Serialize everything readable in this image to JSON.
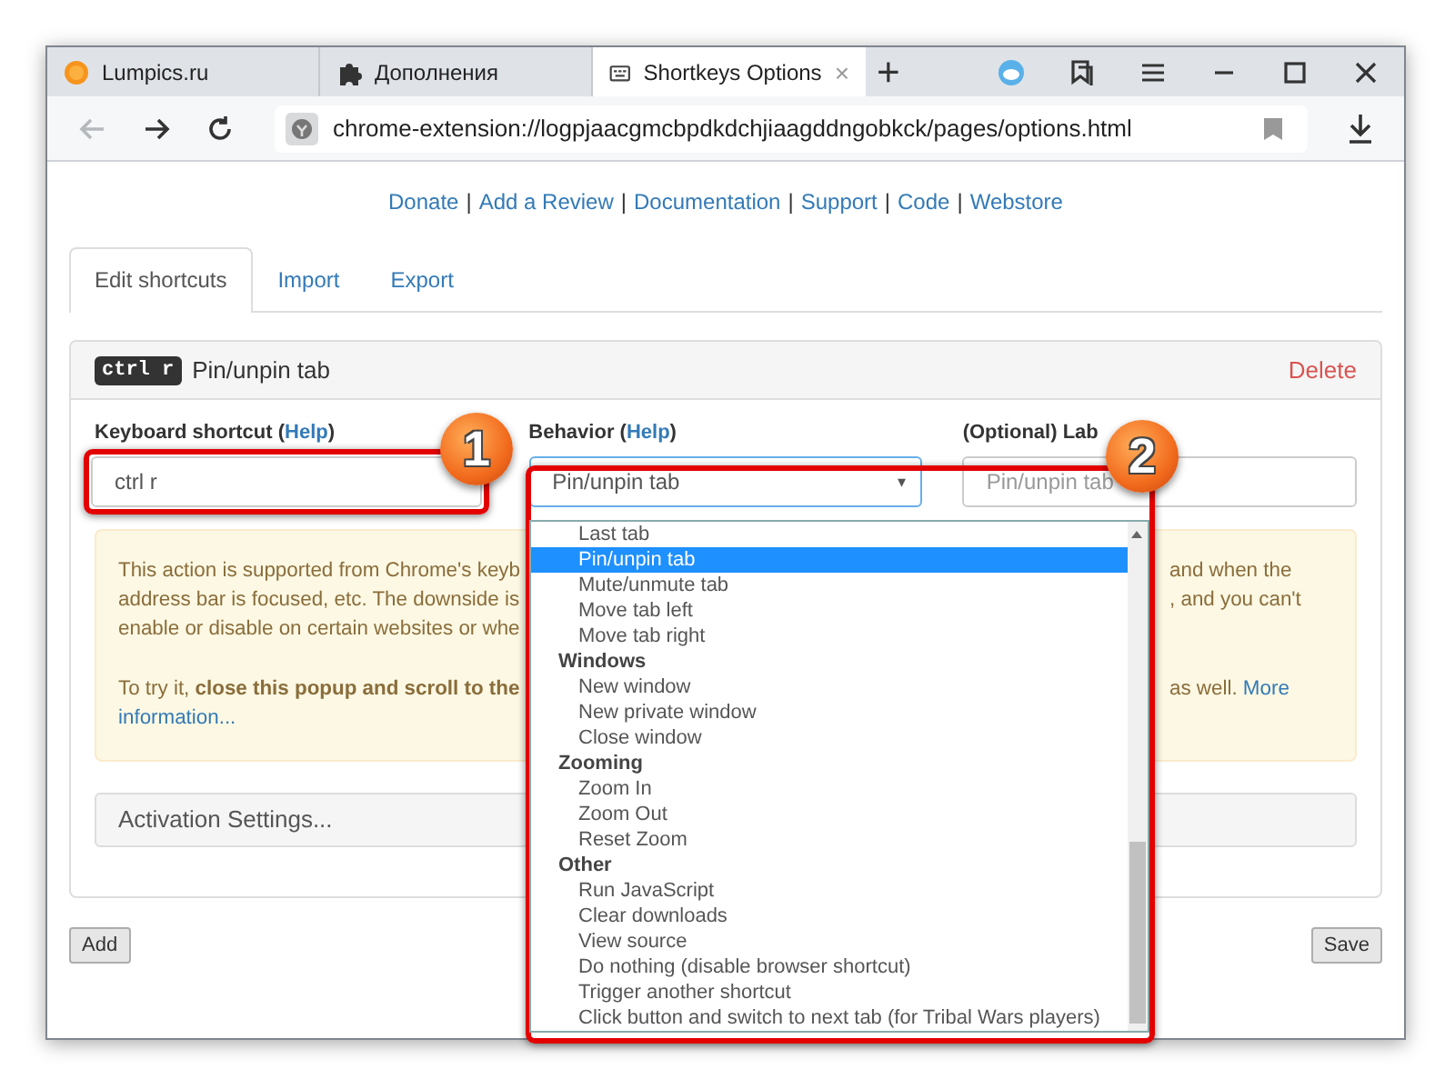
{
  "browser": {
    "tabs": [
      {
        "kind": "site",
        "title": "Lumpics.ru",
        "selected": false
      },
      {
        "kind": "puzzle",
        "title": "Дополнения",
        "selected": false
      },
      {
        "kind": "keyboard",
        "title": "Shortkeys Options",
        "selected": true,
        "close": "×"
      }
    ],
    "new_tab": "+",
    "nav": [
      {
        "kind": "back",
        "disabled": true
      },
      {
        "kind": "forward",
        "disabled": false
      },
      {
        "kind": "reload",
        "disabled": false
      }
    ],
    "url": "chrome-extension://logpjaacgmcbpdkdchjiaagddngobkck/pages/options.html"
  },
  "links": [
    {
      "label": "Donate",
      "separator": "|"
    },
    {
      "label": "Add a Review",
      "separator": "|"
    },
    {
      "label": "Documentation",
      "separator": "|"
    },
    {
      "label": "Support",
      "separator": "|"
    },
    {
      "label": "Code",
      "separator": "|"
    },
    {
      "label": "Webstore"
    }
  ],
  "page_tabs": [
    {
      "label": "Edit shortcuts",
      "selected": true
    },
    {
      "label": "Import",
      "selected": false
    },
    {
      "label": "Export",
      "selected": false
    }
  ],
  "shortcut_panel": {
    "keys": "ctrl r",
    "title": "Pin/unpin tab",
    "delete": "Delete",
    "fields": [
      {
        "kind": "input",
        "label": "Keyboard shortcut (",
        "help": "Help",
        "label_end": ")",
        "value": "ctrl r",
        "highlighted": true
      },
      {
        "kind": "select",
        "label": "Behavior (",
        "help": "Help",
        "label_end": ")",
        "value": "Pin/unpin tab",
        "caret": "▾",
        "highlighted": true
      },
      {
        "kind": "input",
        "label": "(Optional) Lab",
        "placeholder": "Pin/unpin tab",
        "highlighted": false
      }
    ],
    "alert": [
      {
        "kind": "row",
        "left": "This action is supported from Chrome's keyb",
        "right": "and when the"
      },
      {
        "kind": "row",
        "left": "address bar is focused, etc. The downside is",
        "right": ", and you can't"
      },
      {
        "kind": "row",
        "left": "enable or disable on certain websites or whe"
      },
      {
        "kind": "gap"
      },
      {
        "kind": "row",
        "left": "To try it, **close this popup and scroll to the**",
        "right": "as well.",
        "right_link": "More"
      },
      {
        "kind": "row",
        "left_link": "information..."
      }
    ],
    "activation": "Activation Settings..."
  },
  "dropdown": {
    "options": [
      {
        "kind": "option",
        "label": "Last tab",
        "selected": false
      },
      {
        "kind": "option",
        "label": "Pin/unpin tab",
        "selected": true
      },
      {
        "kind": "option",
        "label": "Mute/unmute tab",
        "selected": false
      },
      {
        "kind": "option",
        "label": "Move tab left",
        "selected": false
      },
      {
        "kind": "option",
        "label": "Move tab right",
        "selected": false
      },
      {
        "kind": "group",
        "label": "Windows"
      },
      {
        "kind": "option",
        "label": "New window",
        "selected": false
      },
      {
        "kind": "option",
        "label": "New private window",
        "selected": false
      },
      {
        "kind": "option",
        "label": "Close window",
        "selected": false
      },
      {
        "kind": "group",
        "label": "Zooming"
      },
      {
        "kind": "option",
        "label": "Zoom In",
        "selected": false
      },
      {
        "kind": "option",
        "label": "Zoom Out",
        "selected": false
      },
      {
        "kind": "option",
        "label": "Reset Zoom",
        "selected": false
      },
      {
        "kind": "group",
        "label": "Other"
      },
      {
        "kind": "option",
        "label": "Run JavaScript",
        "selected": false
      },
      {
        "kind": "option",
        "label": "Clear downloads",
        "selected": false
      },
      {
        "kind": "option",
        "label": "View source",
        "selected": false
      },
      {
        "kind": "option",
        "label": "Do nothing (disable browser shortcut)",
        "selected": false
      },
      {
        "kind": "option",
        "label": "Trigger another shortcut",
        "selected": false
      },
      {
        "kind": "option",
        "label": "Click button and switch to next tab (for Tribal Wars players)",
        "selected": false
      }
    ]
  },
  "buttons": {
    "add": "Add",
    "save": "Save"
  },
  "annotations": [
    {
      "number": "1"
    },
    {
      "number": "2"
    }
  ]
}
